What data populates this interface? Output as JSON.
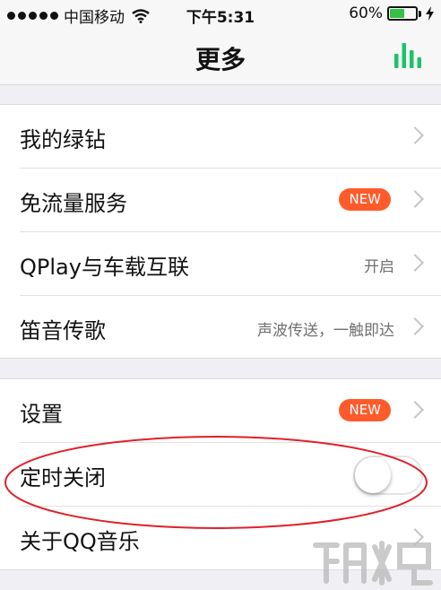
{
  "status_bar": {
    "carrier": "中国移动",
    "time": "下午5:31",
    "battery_percent": "60%",
    "battery_level": 0.6,
    "battery_color": "#35c046",
    "icons": [
      "signal-dots-icon",
      "wifi-icon",
      "battery-icon",
      "charging-bolt-icon"
    ]
  },
  "nav": {
    "title": "更多",
    "accent_color": "#1fc26a",
    "right_icon": "equalizer-bars-icon"
  },
  "section1": [
    {
      "label": "我的绿钻"
    },
    {
      "label": "免流量服务",
      "badge": "NEW"
    },
    {
      "label": "QPlay与车载互联",
      "detail": "开启"
    },
    {
      "label": "笛音传歌",
      "detail": "声波传送，一触即达"
    }
  ],
  "section2": [
    {
      "label": "设置",
      "badge": "NEW"
    },
    {
      "label": "定时关闭",
      "toggle_on": false
    },
    {
      "label": "关于QQ音乐"
    }
  ],
  "badge_color": "#ff5a2c",
  "annotation_color": "#e0202a"
}
